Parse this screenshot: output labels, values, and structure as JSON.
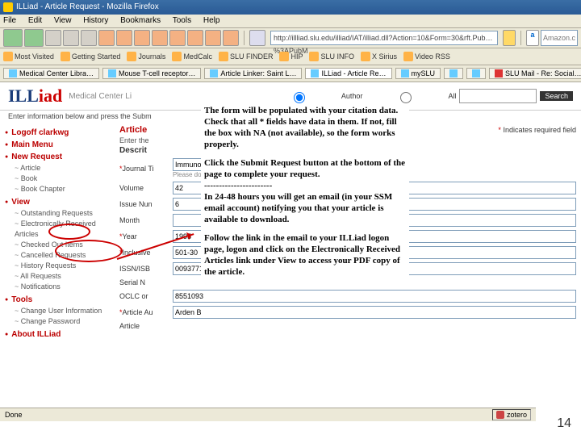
{
  "window": {
    "title": "ILLiad - Article Request - Mozilla Firefox"
  },
  "menu": {
    "file": "File",
    "edit": "Edit",
    "view": "View",
    "history": "History",
    "bookmarks": "Bookmarks",
    "tools": "Tools",
    "help": "Help"
  },
  "toolbar": {
    "url": "http://illliad.slu.edu/illiad/IAT/illiad.dll?Action=10&Form=30&rft.Pub…%3APubM",
    "go_placeholder": "Amazon.com"
  },
  "bookmarks": [
    "Most Visited",
    "Getting Started",
    "Journals",
    "MedCalc",
    "SLU FINDER",
    "HIP",
    "SLU INFO",
    "X Sirius",
    "Video RSS"
  ],
  "tabs": [
    "Medical Center Libra…",
    "Mouse T-cell receptor…",
    "Article Linker: Saint L…",
    "ILLiad - Article Re…",
    "mySLU",
    "",
    "",
    "SLU Mail - Re: Social…"
  ],
  "illiad": {
    "logo": "ILLiad",
    "subtitle": "Medical Center Li",
    "search_btn": "Search",
    "radio1": "Author",
    "radio2": "All",
    "instruction": "Enter information below and press the Subm"
  },
  "sidebar": {
    "logoff": "Logoff clarkwg",
    "mainmenu": "Main Menu",
    "newreq": "New Request",
    "nr": {
      "a": "Article",
      "b": "Book",
      "c": "Book Chapter"
    },
    "view": "View",
    "v": {
      "a": "Outstanding Requests",
      "b": "Electronically Received Articles",
      "c": "Checked Out Items",
      "d": "Cancelled Requests",
      "e": "History Requests",
      "f": "All Requests",
      "g": "Notifications"
    },
    "tools": "Tools",
    "t": {
      "a": "Change User Information",
      "b": "Change Password"
    },
    "about": "About ILLiad"
  },
  "form": {
    "section": "Article",
    "enter": "Enter the",
    "descr": "Descrit",
    "required": "Indicates required field",
    "star": "*",
    "rows": {
      "jt": {
        "label": "Journal Ti",
        "note": "Please do",
        "val": "Immunogenetics (New York)"
      },
      "vol": {
        "label": "Volume",
        "val": "42"
      },
      "iss": {
        "label": "Issue Nun",
        "val": "6"
      },
      "mon": {
        "label": "Month",
        "val": ""
      },
      "yr": {
        "label": "Year",
        "val": "1995"
      },
      "inc": {
        "label": "Inclusive",
        "val": "501-30"
      },
      "issn": {
        "label": "ISSN/ISB",
        "val": "00937711"
      },
      "ser": {
        "label": "Serial N"
      },
      "oclc": {
        "label": "OCLC or",
        "val": "8551093"
      },
      "au": {
        "label": "Article Au",
        "val": "Arden B"
      },
      "at": {
        "label": "Article"
      }
    }
  },
  "overlay": {
    "p1": "The form will be populated with your citation data. Check that all * fields have data in them. If not, fill the box with NA (not available), so the form works properly.",
    "p2": "Click the Submit Request button at the bottom of the page to complete your request.",
    "dash": "-----------------------",
    "p3": "In 24-48 hours you will get an email (in your SSM email account) notifying you that your article is available to download.",
    "p4": "Follow the link in the email to your ILLiad logon page, logon and click on the Electronically Received Articles link under View to access your PDF copy of the article."
  },
  "status": {
    "done": "Done",
    "zotero": "zotero"
  },
  "slide": "14"
}
